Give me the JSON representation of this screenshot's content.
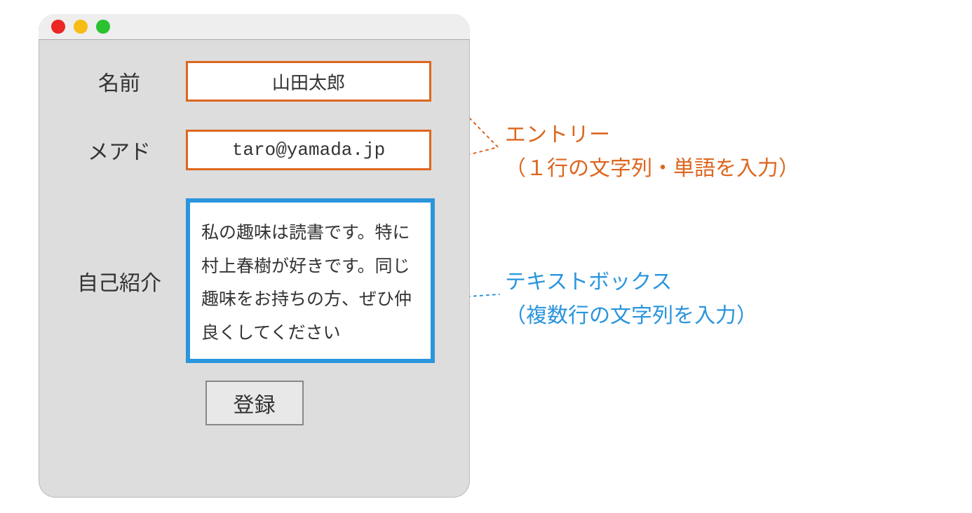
{
  "form": {
    "name_label": "名前",
    "name_value": "山田太郎",
    "email_label": "メアド",
    "email_value": "taro@yamada.jp",
    "bio_label": "自己紹介",
    "bio_value": "私の趣味は読書です。特に村上春樹が好きです。同じ趣味をお持ちの方、ぜひ仲良くしてください",
    "submit_label": "登録"
  },
  "annotations": {
    "entry_title": "エントリー",
    "entry_desc": "（１行の文字列・単語を入力）",
    "textbox_title": "テキストボックス",
    "textbox_desc": "（複数行の文字列を入力）"
  },
  "colors": {
    "entry_border": "#dd661f",
    "textbox_border": "#2a95dd",
    "window_bg": "#ddd"
  }
}
